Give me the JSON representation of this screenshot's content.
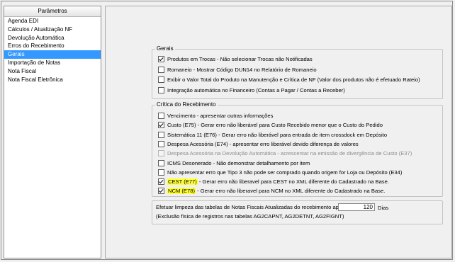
{
  "sidebar": {
    "header": "Parâmetros",
    "items": [
      {
        "label": "Agenda EDI",
        "selected": false
      },
      {
        "label": "Cálculos / Atualização NF",
        "selected": false
      },
      {
        "label": "Devolução Automática",
        "selected": false
      },
      {
        "label": "Erros do Recebimento",
        "selected": false
      },
      {
        "label": "Gerais",
        "selected": true
      },
      {
        "label": "Importação de Notas",
        "selected": false
      },
      {
        "label": "Nota Fiscal",
        "selected": false
      },
      {
        "label": "Nota Fiscal Eletrônica",
        "selected": false
      }
    ]
  },
  "gerais": {
    "title": "Gerais",
    "options": [
      {
        "label": "Produtos em Trocas - Não selecionar Trocas não Notificadas",
        "checked": true
      },
      {
        "label": "Romaneio - Mostrar Código DUN14 no Relatório de Romaneio",
        "checked": false
      },
      {
        "label": "Exibir o Valor Total do Produto na Manutenção e Crítica de NF  (Valor dos produtos não é efetuado Rateio)",
        "checked": false
      },
      {
        "label": "Integração automática no Financeiro (Contas a Pagar / Contas a Receber)",
        "checked": false
      }
    ]
  },
  "critica": {
    "title": "Crítica do Recebimento",
    "options": [
      {
        "label": "Vencimento - apresentar outras informações",
        "checked": false,
        "disabled": false
      },
      {
        "label": "Custo (E75) - Gerar erro não liberável para Custo Recebido menor que o Custo do Pedido",
        "checked": true,
        "disabled": false
      },
      {
        "label": "Sistemática 11 (E76) - Gerar erro não liberável para entrada de item crossdock em Depósito",
        "checked": false,
        "disabled": false
      },
      {
        "label": "Despesa Acessória (E74) - apresentar erro liberável devido diferença de valores",
        "checked": false,
        "disabled": false
      },
      {
        "label": "Despesa Acessória na Devolução Automática - acrescentar na emissão de divergência de Custo (E37)",
        "checked": false,
        "disabled": true
      },
      {
        "label": "ICMS Desonerado - Não demonstrar detalhamento por item",
        "checked": false,
        "disabled": false
      },
      {
        "label": "Não apresentar erro que Tipo 3 não pode ser comprado quando origem for Loja ou Depósito (E34)",
        "checked": false,
        "disabled": false
      },
      {
        "highlight": "CEST (E77)",
        "label": " - Gerar erro não liberavel para CEST no XML diferente do Cadastrado na Base.",
        "checked": true,
        "disabled": false
      },
      {
        "highlight": "NCM (E78)",
        "label": " - Gerar erro não liberavel para NCM no XML diferente do Cadastrado na Base.",
        "checked": true,
        "disabled": false
      }
    ]
  },
  "limpeza": {
    "label": "Efetuar limpeza das tabelas de Notas Fiscais Atualizadas do recebimento após:",
    "value": "120",
    "unit": "Dias",
    "note": "(Exclusão física de registros nas tabelas AG2CAPNT, AG2DETNT, AG2FIGNT)"
  },
  "colors": {
    "selection": "#3399ff",
    "highlight": "#ffff3b"
  }
}
